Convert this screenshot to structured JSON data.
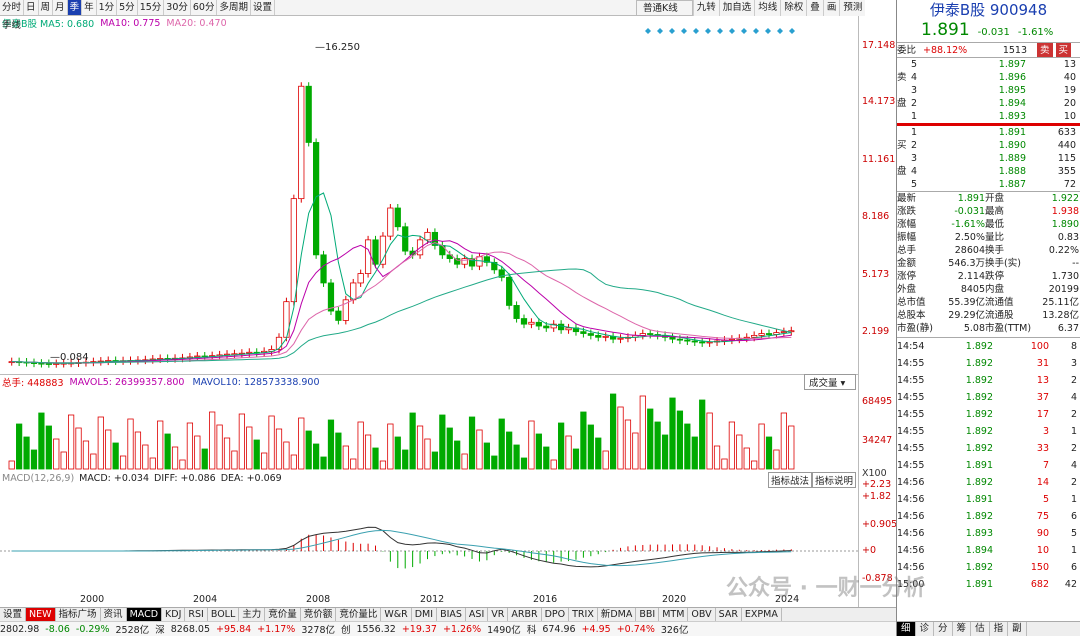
{
  "toolbar": {
    "tabs": [
      "分时",
      "日",
      "周",
      "月",
      "季",
      "年",
      "1分",
      "5分",
      "15分",
      "30分",
      "60分",
      "多周期",
      "设置"
    ],
    "selected_tab": "季",
    "right_items": [
      "普通K线",
      "九转",
      "加自选",
      "均线",
      "除权",
      "叠",
      "画",
      "预测"
    ]
  },
  "price_legend": {
    "name": "季线",
    "ma5": "伊泰B股 MA5: 0.680",
    "ma10": "MA10: 0.775",
    "ma20": "MA20: 0.470",
    "high_label": "16.250",
    "low_label": "0.084"
  },
  "price_axis": [
    "17.148",
    "14.173",
    "11.161",
    "8.186",
    "5.173",
    "2.199"
  ],
  "volume": {
    "head": "总手: 448883",
    "mavol5": "MAVOL5: 26399357.800",
    "mavol10": "MAVOL10: 128573338.900",
    "dropdown": "成交量",
    "axis": [
      "68495",
      "34247",
      "X100"
    ],
    "btn1": "指标战法",
    "btn2": "指标说明"
  },
  "macd": {
    "name": "MACD(12,26,9)",
    "macd": "MACD: +0.034",
    "diff": "DIFF: +0.086",
    "dea": "DEA: +0.069",
    "axis": [
      "+2.23",
      "+1.82",
      "+0.905",
      "+0",
      "-0.878"
    ]
  },
  "years": [
    "2000",
    "2004",
    "2008",
    "2012",
    "2016",
    "2020",
    "2024"
  ],
  "bottom_tabs": [
    "设置",
    "NEW",
    "指标广场",
    "资讯",
    "MACD",
    "KDJ",
    "RSI",
    "BOLL",
    "主力",
    "竞价量",
    "竞价额",
    "竞价量比",
    "W&R",
    "DMI",
    "BIAS",
    "ASI",
    "VR",
    "ARBR",
    "DPO",
    "TRIX",
    "新DMA",
    "BBI",
    "MTM",
    "OBV",
    "SAR",
    "EXPMA"
  ],
  "bottom_selected": "MACD",
  "ticker": [
    "2802.98",
    "-8.06",
    "-0.29%",
    "2528亿",
    "深",
    "8268.05",
    "+95.84",
    "+1.17%",
    "3278亿",
    "创",
    "1556.32",
    "+19.37",
    "+1.26%",
    "1490亿",
    "科",
    "674.96",
    "+4.95",
    "+0.74%",
    "326亿"
  ],
  "side": {
    "title": "伊泰B股 900948",
    "price": "1.891",
    "change": "-0.031",
    "pct": "-1.61%",
    "weibi": "委比",
    "weibi_val": "+88.12%",
    "weicha": "1513",
    "sell_btn": "卖",
    "buy_btn": "买",
    "sell_label": [
      "卖",
      "盘"
    ],
    "buy_label": [
      "买",
      "盘"
    ],
    "asks": [
      [
        "5",
        "1.897",
        "13"
      ],
      [
        "4",
        "1.896",
        "40"
      ],
      [
        "3",
        "1.895",
        "19"
      ],
      [
        "2",
        "1.894",
        "20"
      ],
      [
        "1",
        "1.893",
        "10"
      ]
    ],
    "bids": [
      [
        "1",
        "1.891",
        "633"
      ],
      [
        "2",
        "1.890",
        "440"
      ],
      [
        "3",
        "1.889",
        "115"
      ],
      [
        "4",
        "1.888",
        "355"
      ],
      [
        "5",
        "1.887",
        "72"
      ]
    ],
    "stats": [
      [
        "最新",
        "1.891",
        "开盘",
        "1.922"
      ],
      [
        "涨跌",
        "-0.031",
        "最高",
        "1.938"
      ],
      [
        "涨幅",
        "-1.61%",
        "最低",
        "1.890"
      ],
      [
        "振幅",
        "2.50%",
        "量比",
        "0.83"
      ],
      [
        "总手",
        "28604",
        "换手",
        "0.22%"
      ],
      [
        "金额",
        "546.3万",
        "换手(实)",
        "--"
      ],
      [
        "涨停",
        "2.114",
        "跌停",
        "1.730"
      ],
      [
        "外盘",
        "8405",
        "内盘",
        "20199"
      ],
      [
        "总市值",
        "55.39亿",
        "流通值",
        "25.11亿"
      ],
      [
        "总股本",
        "29.29亿",
        "流通股",
        "13.28亿"
      ],
      [
        "市盈(静)",
        "5.08",
        "市盈(TTM)",
        "6.37"
      ]
    ],
    "ticks": [
      [
        "14:54",
        "1.892",
        "100",
        "8"
      ],
      [
        "14:55",
        "1.892",
        "31",
        "3"
      ],
      [
        "14:55",
        "1.892",
        "13",
        "2"
      ],
      [
        "14:55",
        "1.892",
        "37",
        "4"
      ],
      [
        "14:55",
        "1.892",
        "17",
        "2"
      ],
      [
        "14:55",
        "1.892",
        "3",
        "1"
      ],
      [
        "14:55",
        "1.892",
        "33",
        "2"
      ],
      [
        "14:55",
        "1.891",
        "7",
        "4"
      ],
      [
        "14:56",
        "1.892",
        "14",
        "2"
      ],
      [
        "14:56",
        "1.891",
        "5",
        "1"
      ],
      [
        "14:56",
        "1.892",
        "75",
        "6"
      ],
      [
        "14:56",
        "1.893",
        "90",
        "5"
      ],
      [
        "14:56",
        "1.894",
        "10",
        "1"
      ],
      [
        "14:56",
        "1.892",
        "150",
        "6"
      ],
      [
        "15:00",
        "1.891",
        "682",
        "42"
      ]
    ],
    "side_tabs": [
      "细",
      "诊",
      "分",
      "筹",
      "估",
      "指",
      "副"
    ]
  },
  "watermark": "公众号 · 一财一分析"
}
